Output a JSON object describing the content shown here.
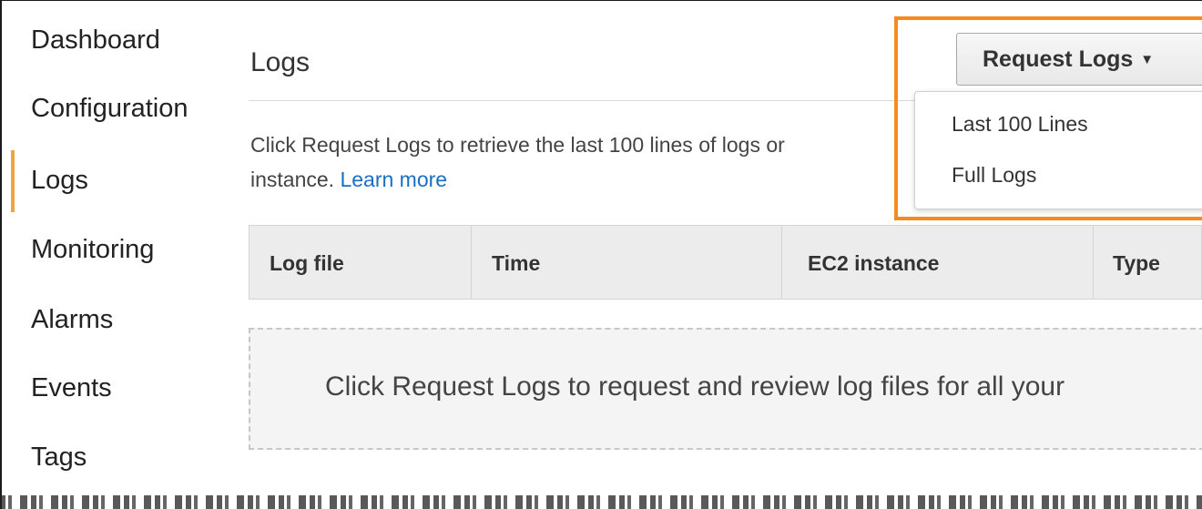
{
  "sidebar": {
    "items": [
      {
        "label": "Dashboard"
      },
      {
        "label": "Configuration"
      },
      {
        "label": "Logs",
        "active": true
      },
      {
        "label": "Monitoring"
      },
      {
        "label": "Alarms"
      },
      {
        "label": "Events"
      },
      {
        "label": "Tags"
      }
    ]
  },
  "main": {
    "title": "Logs",
    "description": "Click Request Logs to retrieve the last 100 lines of logs or",
    "description_line2": "instance.",
    "learn_more": "Learn more",
    "request_button": {
      "label": "Request Logs",
      "caret": "▼"
    },
    "dropdown": {
      "items": [
        {
          "label": "Last 100 Lines"
        },
        {
          "label": "Full Logs"
        }
      ]
    },
    "table": {
      "columns": [
        "Log file",
        "Time",
        "EC2 instance",
        "Type"
      ]
    },
    "empty_message": "Click Request Logs to request and review log files for all your"
  },
  "colors": {
    "highlight": "#f58a1f",
    "active_nav": "#f0a540",
    "link": "#1a6fc4"
  }
}
